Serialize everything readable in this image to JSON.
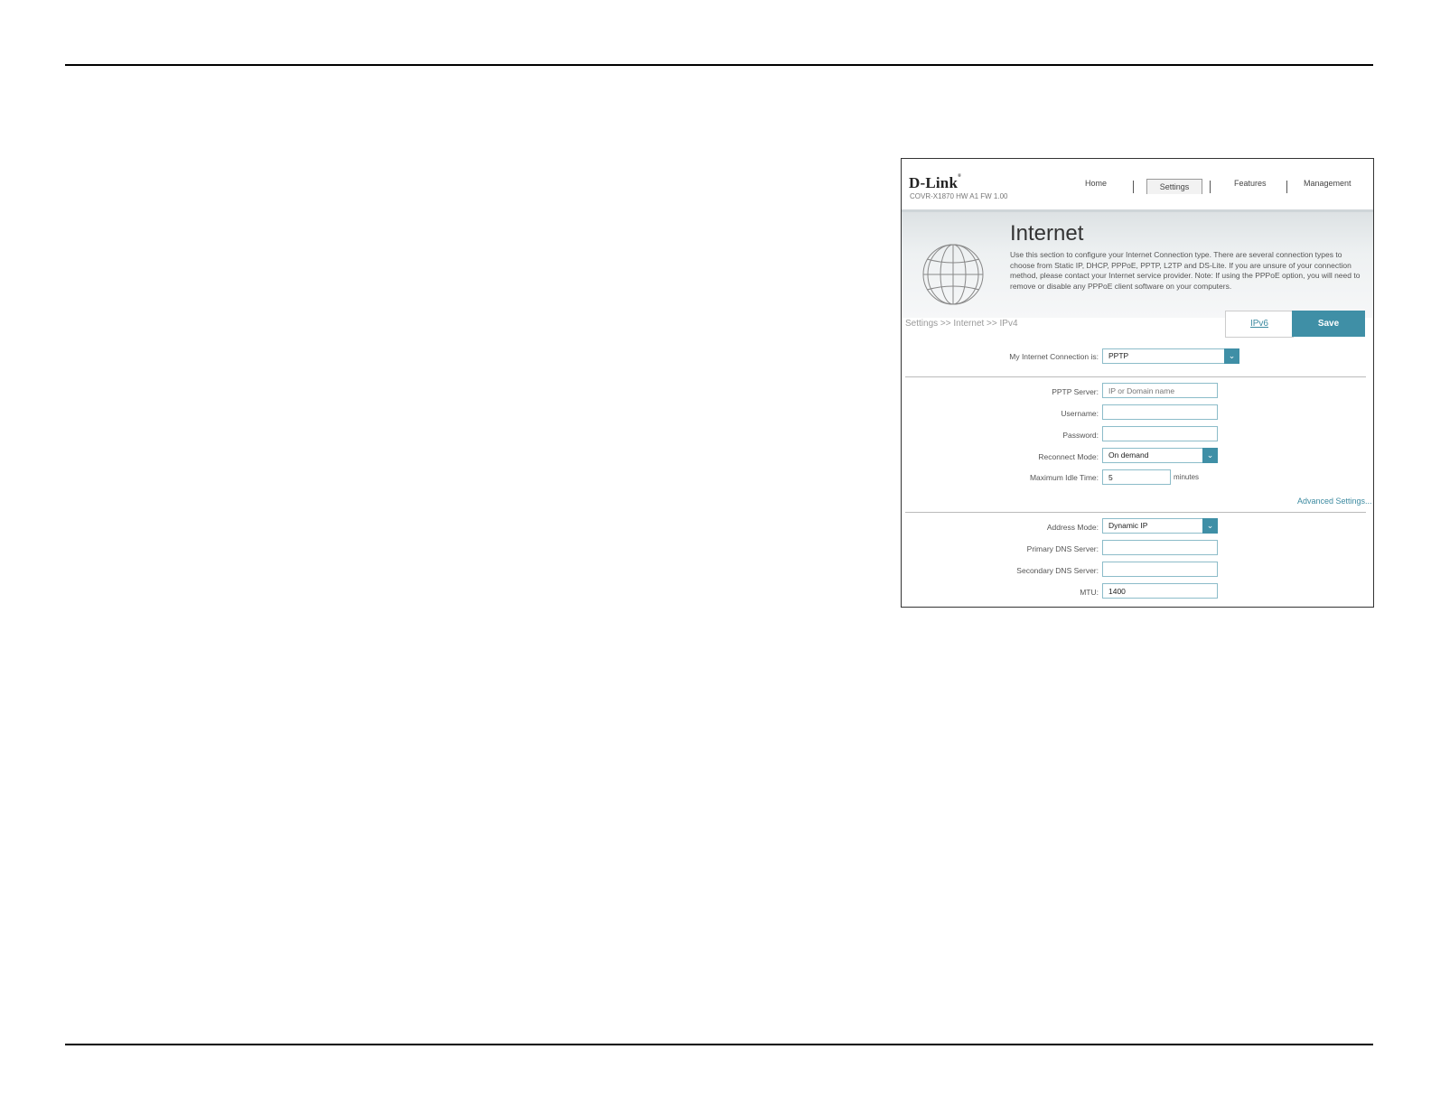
{
  "header": {
    "brand": "D-Link",
    "model": "COVR-X1870 HW A1 FW 1.00",
    "nav": [
      "Home",
      "Settings",
      "Features",
      "Management"
    ],
    "active_nav": "Settings"
  },
  "banner": {
    "title": "Internet",
    "description": "Use this section to configure your Internet Connection type. There are several connection types to choose from Static IP, DHCP, PPPoE, PPTP, L2TP and DS-Lite. If you are unsure of your connection method, please contact your Internet service provider. Note: If using the PPPoE option, you will need to remove or disable any PPPoE client software on your computers."
  },
  "breadcrumb": "Settings >> Internet >> IPv4",
  "buttons": {
    "ipv6": "IPv6",
    "save": "Save"
  },
  "connection": {
    "label": "My Internet Connection is:",
    "value": "PPTP"
  },
  "pptp": {
    "server_label": "PPTP Server:",
    "server_placeholder": "IP or Domain name",
    "username_label": "Username:",
    "username_value": "",
    "password_label": "Password:",
    "password_value": "",
    "reconnect_label": "Reconnect Mode:",
    "reconnect_value": "On demand",
    "idle_label": "Maximum Idle Time:",
    "idle_value": "5",
    "idle_unit": "minutes",
    "advanced_link": "Advanced Settings..."
  },
  "address": {
    "mode_label": "Address Mode:",
    "mode_value": "Dynamic IP",
    "primary_dns_label": "Primary DNS Server:",
    "primary_dns_value": "",
    "secondary_dns_label": "Secondary DNS Server:",
    "secondary_dns_value": "",
    "mtu_label": "MTU:",
    "mtu_value": "1400"
  },
  "colors": {
    "accent": "#3f8fa6",
    "field_border": "#8cbcc9"
  }
}
